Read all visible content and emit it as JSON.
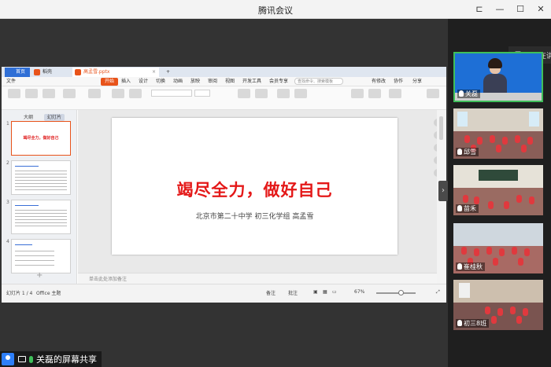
{
  "window": {
    "title": "腾讯会议"
  },
  "wps": {
    "tabs": [
      {
        "label": "首页",
        "color": "#2f6fd6"
      },
      {
        "label": "稻壳",
        "color": "#e8531a"
      },
      {
        "label": "高孟雪.pptx",
        "color": "#e8531a"
      }
    ],
    "menu": [
      "文件",
      "开始",
      "插入",
      "设计",
      "切换",
      "动画",
      "放映",
      "审阅",
      "视图",
      "开发工具",
      "会员专享"
    ],
    "menu_active": "开始",
    "search_placeholder": "查找命令、搜索模板",
    "menu_right": [
      "有修改",
      "协作",
      "分享"
    ],
    "left_tabs": [
      "大纲",
      "幻灯片"
    ],
    "slide_numbers": [
      "1",
      "2",
      "3",
      "4"
    ],
    "thumb1_title": "竭尽全力，做好自己",
    "notes_placeholder": "单击此处添加备注",
    "status": {
      "slide_info": "幻灯片 1 / 4",
      "theme": "Office 主题",
      "notes_btn": "备注",
      "comments_btn": "批注",
      "zoom": "67%"
    }
  },
  "slide": {
    "title": "竭尽全力，做好自己",
    "subtitle": "北京市第二十中学  初三化学组  高孟雪"
  },
  "participants": [
    {
      "name": "关磊"
    },
    {
      "name": "邱雪"
    },
    {
      "name": "苗禾"
    },
    {
      "name": "崔桂秋"
    },
    {
      "name": "初三8班"
    }
  ],
  "speaking_text": "正在讲",
  "share_label": "关磊的屏幕共享",
  "colors": {
    "accent": "#e8531a",
    "speaker_border": "#3fbf5a",
    "title_red": "#e41818"
  }
}
